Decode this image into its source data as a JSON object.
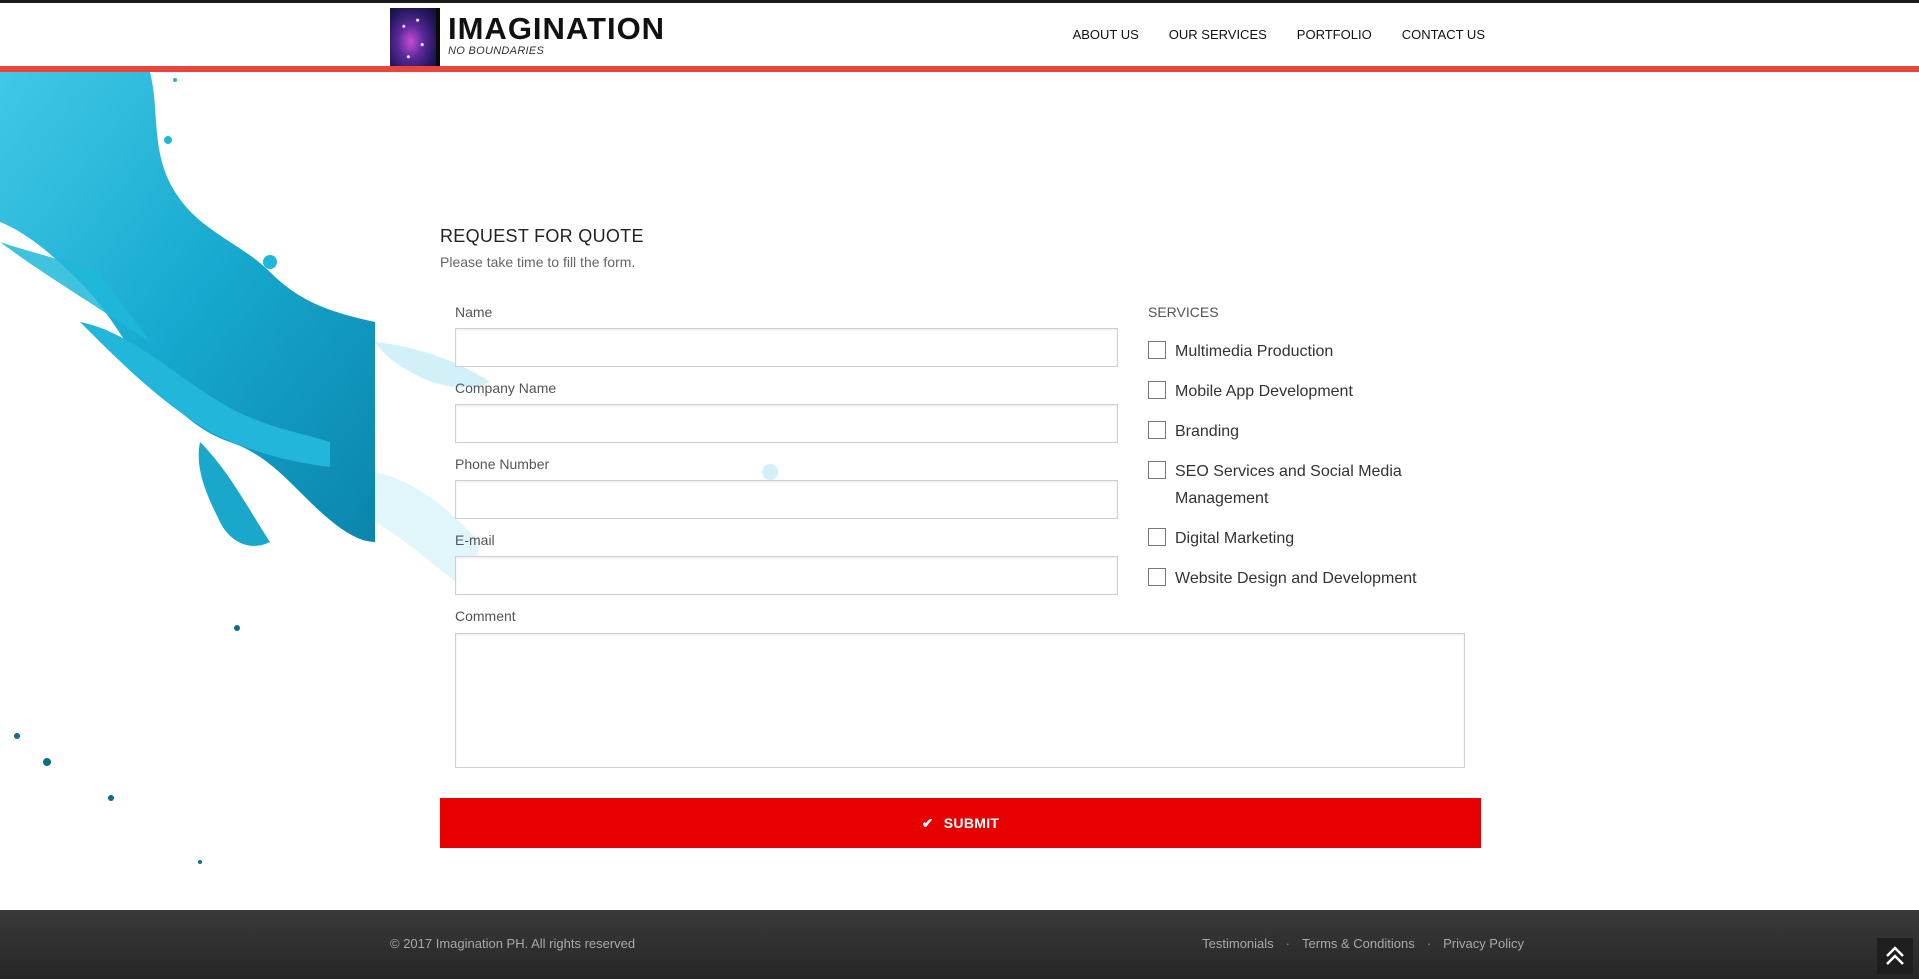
{
  "header": {
    "logo_title": "IMAGINATION",
    "logo_tagline": "NO BOUNDARIES",
    "nav": [
      {
        "label": "ABOUT US"
      },
      {
        "label": "OUR SERVICES"
      },
      {
        "label": "PORTFOLIO"
      },
      {
        "label": "CONTACT US"
      }
    ]
  },
  "form": {
    "title": "REQUEST FOR QUOTE",
    "subtitle": "Please take time to fill the form.",
    "fields": [
      {
        "label": "Name",
        "value": ""
      },
      {
        "label": "Company Name",
        "value": ""
      },
      {
        "label": "Phone Number",
        "value": ""
      },
      {
        "label": "E-mail",
        "value": ""
      }
    ],
    "comment_label": "Comment",
    "comment_value": "",
    "services_label": "SERVICES",
    "services": [
      {
        "label": "Multimedia Production",
        "checked": false
      },
      {
        "label": "Mobile App Development",
        "checked": false
      },
      {
        "label": "Branding",
        "checked": false
      },
      {
        "label": "SEO Services and Social Media Management",
        "checked": false
      },
      {
        "label": "Digital Marketing",
        "checked": false
      },
      {
        "label": "Website Design and Development",
        "checked": false
      }
    ],
    "submit_label": "SUBMIT"
  },
  "footer": {
    "copyright": "© 2017 Imagination PH. All rights reserved",
    "links": [
      {
        "label": "Testimonials"
      },
      {
        "label": "Terms & Conditions"
      },
      {
        "label": "Privacy Policy"
      }
    ],
    "separator": "·"
  },
  "colors": {
    "accent_red": "#e60000",
    "header_line": "#e8453c",
    "splash_blue": "#1fb8d9",
    "footer_bg": "#2f2f2f"
  },
  "icons": {
    "logo": "galaxy-logo-icon",
    "submit": "check-icon",
    "back_to_top": "double-chevron-up-icon"
  }
}
